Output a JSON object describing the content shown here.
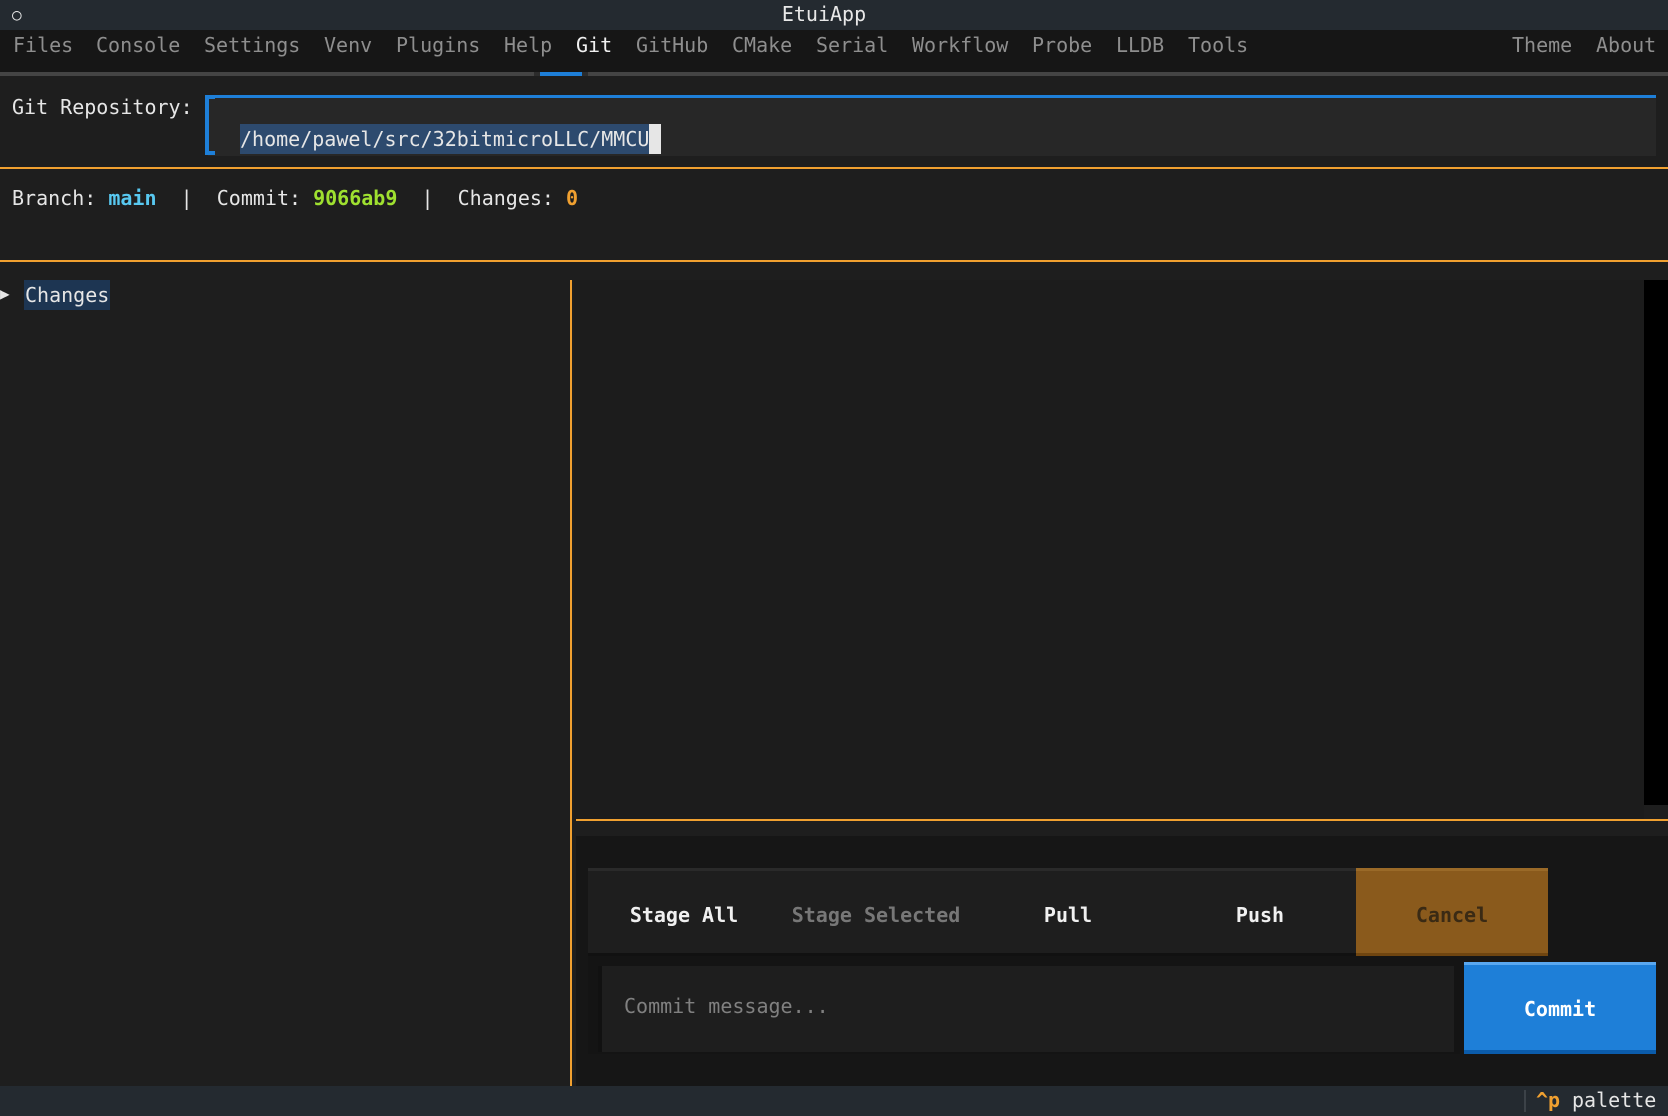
{
  "app": {
    "title": "EtuiApp",
    "window_icon": "circle-icon"
  },
  "tabs": [
    {
      "label": "Files"
    },
    {
      "label": "Console"
    },
    {
      "label": "Settings"
    },
    {
      "label": "Venv"
    },
    {
      "label": "Plugins"
    },
    {
      "label": "Help"
    },
    {
      "label": "Git",
      "active": true
    },
    {
      "label": "GitHub"
    },
    {
      "label": "CMake"
    },
    {
      "label": "Serial"
    },
    {
      "label": "Workflow"
    },
    {
      "label": "Probe"
    },
    {
      "label": "LLDB"
    },
    {
      "label": "Tools"
    }
  ],
  "right_tabs": [
    {
      "label": "Theme"
    },
    {
      "label": "About"
    }
  ],
  "repo": {
    "label": "Git Repository:",
    "path": "/home/pawel/src/32bitmicroLLC/MMCU"
  },
  "status": {
    "branch_label": "Branch:",
    "branch": "main",
    "sep": "|",
    "commit_label": "Commit:",
    "commit": "9066ab9",
    "changes_label": "Changes:",
    "changes": "0"
  },
  "tree": {
    "arrow": "▶",
    "node_label": "Changes"
  },
  "buttons": {
    "stage_all": "Stage All",
    "stage_selected": "Stage Selected",
    "pull": "Pull",
    "push": "Push",
    "cancel": "Cancel",
    "commit": "Commit"
  },
  "commit_message": {
    "placeholder": "Commit message..."
  },
  "footer": {
    "key": "^p",
    "label": "palette"
  },
  "colors": {
    "accent_blue": "#1e7fd8",
    "accent_orange": "#f0a030",
    "branch_cyan": "#58c8f0",
    "commit_green": "#9fe030"
  }
}
